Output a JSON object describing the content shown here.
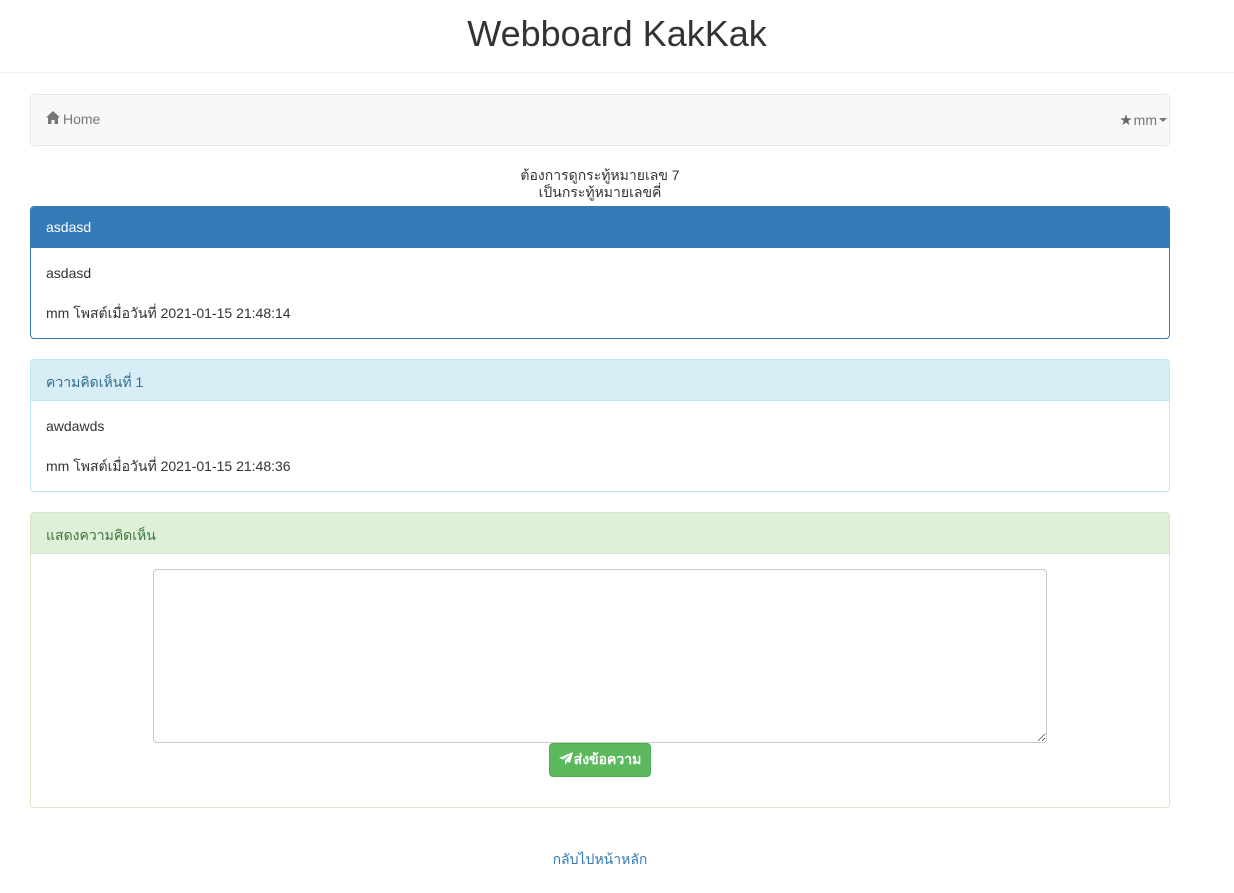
{
  "site": {
    "title": "Webboard KakKak"
  },
  "navbar": {
    "home_label": "Home",
    "home_icon": "home-icon",
    "user_label": "mm",
    "user_icon": "star-icon"
  },
  "info": {
    "line1": "ต้องการดูกระทู้หมายเลข 7",
    "line2": "เป็นกระทู้หมายเลขคี่"
  },
  "topic": {
    "title": "asdasd",
    "body": "asdasd",
    "meta": "mm โพสต์เมื่อวันที่ 2021-01-15 21:48:14"
  },
  "comments": [
    {
      "heading": "ความคิดเห็นที่ 1",
      "body": "awdawds",
      "meta": "mm โพสต์เมื่อวันที่ 2021-01-15 21:48:36"
    }
  ],
  "comment_form": {
    "heading": "แสดงความคิดเห็น",
    "textarea_value": "",
    "send_label": "ส่งข้อความ",
    "send_icon": "send-icon"
  },
  "footer": {
    "back_link": "กลับไปหน้าหลัก"
  },
  "colors": {
    "primary": "#337ab7",
    "info_bg": "#d9edf7",
    "success_bg": "#dff0d8",
    "success_button": "#5cb85c"
  }
}
